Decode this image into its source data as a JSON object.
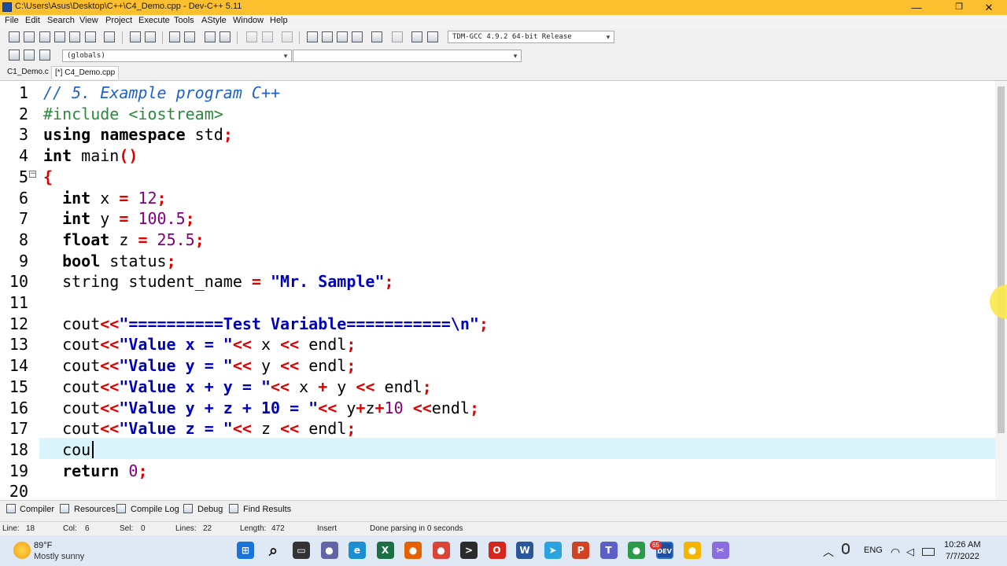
{
  "window": {
    "title": "C:\\Users\\Asus\\Desktop\\C++\\C4_Demo.cpp - Dev-C++ 5.11",
    "controls": {
      "minimize": "—",
      "maximize": "❐",
      "close": "✕"
    }
  },
  "menu": [
    "File",
    "Edit",
    "Search",
    "View",
    "Project",
    "Execute",
    "Tools",
    "AStyle",
    "Window",
    "Help"
  ],
  "toolbar": {
    "compiler_select": "TDM-GCC 4.9.2 64-bit Release",
    "scope_select": "(globals)",
    "symbol_select": ""
  },
  "tabs": [
    {
      "label": "C1_Demo.c",
      "active": false
    },
    {
      "label": "[*] C4_Demo.cpp",
      "active": true
    }
  ],
  "editor": {
    "line_numbers": [
      "1",
      "2",
      "3",
      "4",
      "5",
      "6",
      "7",
      "8",
      "9",
      "10",
      "11",
      "12",
      "13",
      "14",
      "15",
      "16",
      "17",
      "18",
      "19",
      "20"
    ],
    "current_line": 18,
    "lines": [
      "// 5. Example program C++",
      "#include <iostream>",
      "using namespace std;",
      "int main()",
      "{",
      "  int x = 12;",
      "  int y = 100.5;",
      "  float z = 25.5;",
      "  bool status;",
      "  string student_name = \"Mr. Sample\";",
      "",
      "  cout<<\"==========Test Variable===========\\n\";",
      "  cout<<\"Value x = \"<< x << endl;",
      "  cout<<\"Value y = \"<< y << endl;",
      "  cout<<\"Value x + y = \"<< x + y << endl;",
      "  cout<<\"Value y + z + 10 = \"<< y+z+10 <<endl;",
      "  cout<<\"Value z = \"<< z << endl;",
      "  cou",
      "  return 0;",
      ""
    ]
  },
  "bottom_tabs": [
    "Compiler",
    "Resources",
    "Compile Log",
    "Debug",
    "Find Results"
  ],
  "status": {
    "line": "Line:",
    "line_value": "18",
    "col": "Col:",
    "col_value": "6",
    "sel": "Sel:",
    "sel_value": "0",
    "lines": "Lines:",
    "lines_value": "22",
    "length": "Length:",
    "length_value": "472",
    "mode": "Insert",
    "message": "Done parsing in 0 seconds"
  },
  "taskbar": {
    "weather_temp": "89°F",
    "weather_desc": "Mostly sunny",
    "search_glyph": "⌕",
    "lang": "ENG",
    "time": "10:26 AM",
    "date": "7/7/2022",
    "badge": "65",
    "apps": [
      {
        "name": "start-icon",
        "color": "#1a73d9",
        "glyph": "⊞"
      },
      {
        "name": "search-icon",
        "color": "#dfe9f6",
        "glyph": ""
      },
      {
        "name": "task-view-icon",
        "color": "#333333",
        "glyph": "▭"
      },
      {
        "name": "chat-icon",
        "color": "#6264a7",
        "glyph": "●"
      },
      {
        "name": "edge-icon",
        "color": "#1b8fd1",
        "glyph": "e"
      },
      {
        "name": "excel-icon",
        "color": "#1d7044",
        "glyph": "X"
      },
      {
        "name": "firefox-icon",
        "color": "#e66000",
        "glyph": "●"
      },
      {
        "name": "chrome-icon",
        "color": "#db4437",
        "glyph": "●"
      },
      {
        "name": "terminal-icon",
        "color": "#2b2b2b",
        "glyph": ">"
      },
      {
        "name": "opera-icon",
        "color": "#d7261e",
        "glyph": "O"
      },
      {
        "name": "word-icon",
        "color": "#2b579a",
        "glyph": "W"
      },
      {
        "name": "telegram-icon",
        "color": "#2aa3e0",
        "glyph": "➤"
      },
      {
        "name": "powerpoint-icon",
        "color": "#d04423",
        "glyph": "P"
      },
      {
        "name": "teams-icon",
        "color": "#5b5fc7",
        "glyph": "T"
      },
      {
        "name": "chrome-alt-icon",
        "color": "#2b9a4a",
        "glyph": "●"
      },
      {
        "name": "devcpp-icon",
        "color": "#1f4e9e",
        "glyph": "DEV"
      },
      {
        "name": "chrome2-icon",
        "color": "#f4b400",
        "glyph": "●"
      },
      {
        "name": "snip-icon",
        "color": "#8c6de0",
        "glyph": "✂"
      }
    ]
  }
}
